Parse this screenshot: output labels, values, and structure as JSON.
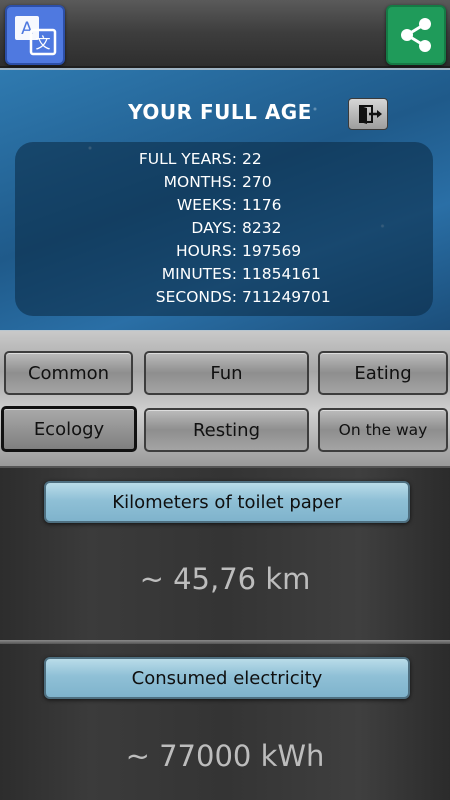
{
  "header": {
    "translate_icon": "translate-icon",
    "share_icon": "share-icon",
    "translate_color": "#4f79e0",
    "share_color": "#1f9b5a"
  },
  "age": {
    "title": "YOUR FULL AGE",
    "exit_icon": "exit-icon",
    "stats": [
      {
        "label": "FULL YEARS:",
        "value": "22"
      },
      {
        "label": "MONTHS:",
        "value": "270"
      },
      {
        "label": "WEEKS:",
        "value": "1176"
      },
      {
        "label": "DAYS:",
        "value": "8232"
      },
      {
        "label": "HOURS:",
        "value": "197569"
      },
      {
        "label": "MINUTES:",
        "value": "11854161"
      },
      {
        "label": "SECONDS:",
        "value": "711249701"
      }
    ]
  },
  "categories": {
    "items": [
      "Common",
      "Fun",
      "Eating",
      "Ecology",
      "Resting",
      "On the way"
    ],
    "selected": "Ecology"
  },
  "facts": [
    {
      "label": "Kilometers of toilet paper",
      "value": "~ 45,76 km"
    },
    {
      "label": "Consumed electricity",
      "value": "~ 77000 kWh"
    }
  ]
}
